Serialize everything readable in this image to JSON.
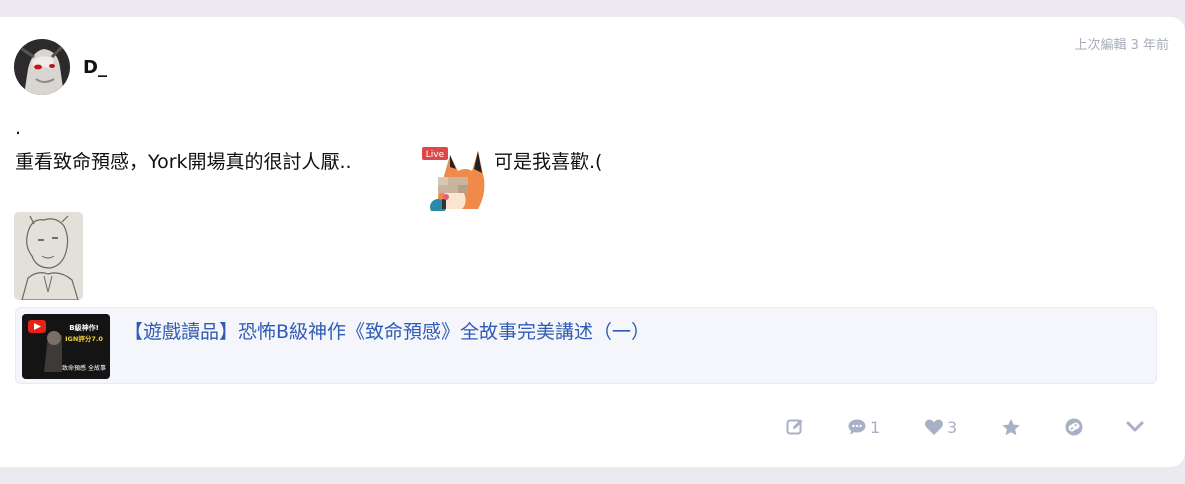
{
  "post": {
    "username": "D_",
    "timestamp": "上次編輯 3 年前",
    "lines": [
      ".",
      "重看致命預感，York開場真的很討人厭..",
      "可是我喜歡.("
    ],
    "sticker": {
      "badge": "Live"
    }
  },
  "link_preview": {
    "title": "【遊戲讀品】恐怖B級神作《致命預感》全故事完美講述（一）",
    "thumb_badge": "B級神作!",
    "thumb_score": "IGN評分7.0",
    "thumb_caption": "致命預感 全故事"
  },
  "actions": {
    "comments_count": "1",
    "likes_count": "3"
  },
  "colors": {
    "link": "#2f5bb5",
    "icon": "#a7b0c4",
    "background": "#eceaf0"
  }
}
